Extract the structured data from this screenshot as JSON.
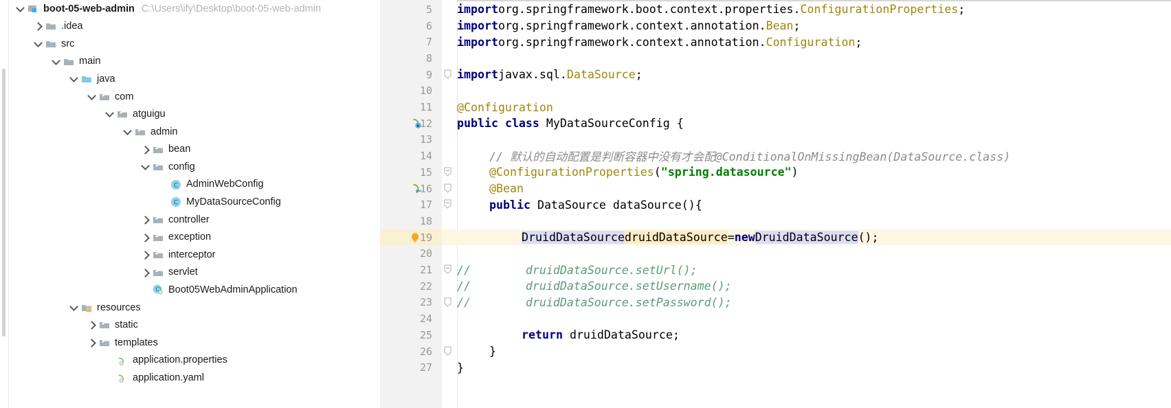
{
  "project_pane": {
    "name": "project-tool-window",
    "scrollbar": {
      "name": "vertical-scrollbar"
    },
    "tree": [
      {
        "depth": 0,
        "twisty": "expanded",
        "icon": "module-icon",
        "label": "boot-05-web-admin",
        "bold": true,
        "path": "C:\\Users\\ify\\Desktop\\boot-05-web-admin"
      },
      {
        "depth": 1,
        "twisty": "collapsed",
        "icon": "folder-icon",
        "label": ".idea",
        "bold": false,
        "path": ""
      },
      {
        "depth": 1,
        "twisty": "expanded",
        "icon": "folder-icon",
        "label": "src",
        "bold": false,
        "path": ""
      },
      {
        "depth": 2,
        "twisty": "expanded",
        "icon": "folder-icon",
        "label": "main",
        "bold": false,
        "path": ""
      },
      {
        "depth": 3,
        "twisty": "expanded",
        "icon": "source-root-icon",
        "label": "java",
        "bold": false,
        "path": ""
      },
      {
        "depth": 4,
        "twisty": "expanded",
        "icon": "package-icon",
        "label": "com",
        "bold": false,
        "path": ""
      },
      {
        "depth": 5,
        "twisty": "expanded",
        "icon": "package-icon",
        "label": "atguigu",
        "bold": false,
        "path": ""
      },
      {
        "depth": 6,
        "twisty": "expanded",
        "icon": "package-icon",
        "label": "admin",
        "bold": false,
        "path": ""
      },
      {
        "depth": 7,
        "twisty": "collapsed",
        "icon": "package-icon",
        "label": "bean",
        "bold": false,
        "path": ""
      },
      {
        "depth": 7,
        "twisty": "expanded",
        "icon": "package-icon",
        "label": "config",
        "bold": false,
        "path": ""
      },
      {
        "depth": 8,
        "twisty": "none",
        "icon": "java-class-icon",
        "label": "AdminWebConfig",
        "bold": false,
        "path": ""
      },
      {
        "depth": 8,
        "twisty": "none",
        "icon": "java-class-icon",
        "label": "MyDataSourceConfig",
        "bold": false,
        "path": ""
      },
      {
        "depth": 7,
        "twisty": "collapsed",
        "icon": "package-icon",
        "label": "controller",
        "bold": false,
        "path": ""
      },
      {
        "depth": 7,
        "twisty": "collapsed",
        "icon": "package-icon",
        "label": "exception",
        "bold": false,
        "path": ""
      },
      {
        "depth": 7,
        "twisty": "collapsed",
        "icon": "package-icon",
        "label": "interceptor",
        "bold": false,
        "path": ""
      },
      {
        "depth": 7,
        "twisty": "collapsed",
        "icon": "package-icon",
        "label": "servlet",
        "bold": false,
        "path": ""
      },
      {
        "depth": 7,
        "twisty": "none",
        "icon": "spring-boot-app-icon",
        "label": "Boot05WebAdminApplication",
        "bold": false,
        "path": ""
      },
      {
        "depth": 3,
        "twisty": "expanded",
        "icon": "resource-root-icon",
        "label": "resources",
        "bold": false,
        "path": ""
      },
      {
        "depth": 4,
        "twisty": "collapsed",
        "icon": "package-icon",
        "label": "static",
        "bold": false,
        "path": ""
      },
      {
        "depth": 4,
        "twisty": "collapsed",
        "icon": "package-icon",
        "label": "templates",
        "bold": false,
        "path": ""
      },
      {
        "depth": 5,
        "twisty": "none",
        "icon": "spring-file-icon",
        "label": "application.properties",
        "bold": false,
        "path": ""
      },
      {
        "depth": 5,
        "twisty": "none",
        "icon": "spring-file-icon",
        "label": "application.yaml",
        "bold": false,
        "path": ""
      }
    ]
  },
  "editor": {
    "name": "code-editor",
    "file": "MyDataSourceConfig",
    "first_line_number": 5,
    "highlighted_line": 19,
    "lines": [
      {
        "num": 5,
        "gutter_icon": "",
        "fold": "",
        "indent": 0,
        "text": "import org.springframework.boot.context.properties.ConfigurationProperties;"
      },
      {
        "num": 6,
        "gutter_icon": "",
        "fold": "",
        "indent": 0,
        "text": "import org.springframework.context.annotation.Bean;"
      },
      {
        "num": 7,
        "gutter_icon": "",
        "fold": "",
        "indent": 0,
        "text": "import org.springframework.context.annotation.Configuration;"
      },
      {
        "num": 8,
        "gutter_icon": "",
        "fold": "",
        "indent": 0,
        "text": ""
      },
      {
        "num": 9,
        "gutter_icon": "",
        "fold": "fold-end",
        "indent": 0,
        "text": "import javax.sql.DataSource;"
      },
      {
        "num": 10,
        "gutter_icon": "",
        "fold": "",
        "indent": 0,
        "text": ""
      },
      {
        "num": 11,
        "gutter_icon": "",
        "fold": "",
        "indent": 0,
        "text": "@Configuration"
      },
      {
        "num": 12,
        "gutter_icon": "spring-bean-class-icon",
        "fold": "",
        "indent": 0,
        "text": "public class MyDataSourceConfig {"
      },
      {
        "num": 13,
        "gutter_icon": "",
        "fold": "",
        "indent": 0,
        "text": ""
      },
      {
        "num": 14,
        "gutter_icon": "",
        "fold": "",
        "indent": 1,
        "text": "// 默认的自动配置是判断容器中没有才会配@ConditionalOnMissingBean(DataSource.class)"
      },
      {
        "num": 15,
        "gutter_icon": "",
        "fold": "fold-collapse",
        "indent": 1,
        "text": "@ConfigurationProperties(\"spring.datasource\")"
      },
      {
        "num": 16,
        "gutter_icon": "spring-bean-method-icon",
        "fold": "fold-end",
        "indent": 1,
        "text": "@Bean"
      },
      {
        "num": 17,
        "gutter_icon": "",
        "fold": "fold-collapse",
        "indent": 1,
        "text": "public DataSource dataSource(){"
      },
      {
        "num": 18,
        "gutter_icon": "",
        "fold": "",
        "indent": 0,
        "text": ""
      },
      {
        "num": 19,
        "gutter_icon": "intention-bulb-icon",
        "fold": "",
        "indent": 2,
        "text": "DruidDataSource druidDataSource = new DruidDataSource();"
      },
      {
        "num": 20,
        "gutter_icon": "",
        "fold": "",
        "indent": 0,
        "text": ""
      },
      {
        "num": 21,
        "gutter_icon": "",
        "fold": "fold-collapse",
        "indent": 0,
        "text": "//        druidDataSource.setUrl();"
      },
      {
        "num": 22,
        "gutter_icon": "",
        "fold": "",
        "indent": 0,
        "text": "//        druidDataSource.setUsername();"
      },
      {
        "num": 23,
        "gutter_icon": "",
        "fold": "fold-end",
        "indent": 0,
        "text": "//        druidDataSource.setPassword();"
      },
      {
        "num": 24,
        "gutter_icon": "",
        "fold": "",
        "indent": 0,
        "text": ""
      },
      {
        "num": 25,
        "gutter_icon": "",
        "fold": "",
        "indent": 2,
        "text": "return druidDataSource;"
      },
      {
        "num": 26,
        "gutter_icon": "",
        "fold": "fold-end",
        "indent": 1,
        "text": "}"
      },
      {
        "num": 27,
        "gutter_icon": "",
        "fold": "",
        "indent": 0,
        "text": "}"
      }
    ]
  },
  "colors": {
    "keyword": "#000080",
    "annotation": "#9e880d",
    "string": "#008000",
    "comment_gray": "#8c8c8c",
    "comment_green": "#5a9c78",
    "highlight_row": "#fdf6e3",
    "selection_blue": "#dcdcf6",
    "selection_yellow": "#fbecc4",
    "gutter_bg": "#f2f2f2"
  }
}
